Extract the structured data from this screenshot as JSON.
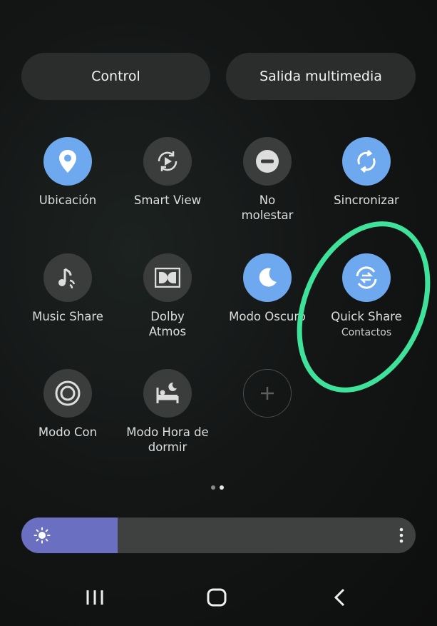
{
  "header": {
    "control_label": "Control",
    "media_label": "Salida multimedia"
  },
  "tiles": [
    {
      "label": "Ubicación",
      "icon": "location-pin-icon",
      "state": "on"
    },
    {
      "label": "Smart View",
      "icon": "smart-view-icon",
      "state": "off"
    },
    {
      "label": "No\nmolestar",
      "icon": "do-not-disturb-icon",
      "state": "off"
    },
    {
      "label": "Sincronizar",
      "icon": "sync-icon",
      "state": "on"
    },
    {
      "label": "Music Share",
      "icon": "music-share-icon",
      "state": "off"
    },
    {
      "label": "Dolby\nAtmos",
      "icon": "dolby-icon",
      "state": "off"
    },
    {
      "label": "Modo Oscuro",
      "icon": "moon-icon",
      "state": "on"
    },
    {
      "label": "Quick Share",
      "sublabel": "Contactos",
      "icon": "quick-share-icon",
      "state": "on"
    },
    {
      "label": "Modo Con",
      "icon": "focus-mode-icon",
      "state": "off"
    },
    {
      "label": "Modo Hora de\ndormir",
      "icon": "bed-icon",
      "state": "off"
    },
    {
      "icon": "add-icon",
      "state": "add"
    }
  ],
  "pager": {
    "pages": 2,
    "current": 2
  },
  "brightness": {
    "level": 0.245
  },
  "colors": {
    "accent": "#6ea8ef",
    "brightness": "#6b6fc2",
    "highlight": "#3ee29a"
  }
}
